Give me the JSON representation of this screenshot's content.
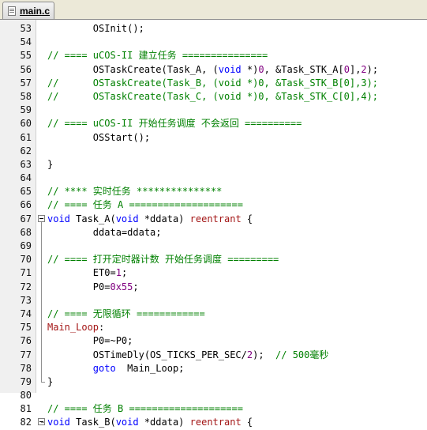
{
  "tab": {
    "label": "main.c",
    "icon": "file-icon"
  },
  "colors": {
    "comment": "#008000",
    "keyword": "#0000ff",
    "number": "#800080",
    "label": "#a31515",
    "gutter_bg": "#f0f0f0"
  },
  "lines": [
    {
      "n": "53",
      "segs": [
        {
          "t": "        "
        },
        {
          "t": "OSInit();"
        }
      ]
    },
    {
      "n": "54",
      "segs": []
    },
    {
      "n": "55",
      "segs": [
        {
          "t": "// ==== uCOS-II 建立任务 ===============",
          "c": "comment"
        }
      ]
    },
    {
      "n": "56",
      "segs": [
        {
          "t": "        OSTaskCreate(Task_A, ("
        },
        {
          "t": "void",
          "c": "keyword"
        },
        {
          "t": " *)"
        },
        {
          "t": "0",
          "c": "number"
        },
        {
          "t": ", &Task_STK_A["
        },
        {
          "t": "0",
          "c": "number"
        },
        {
          "t": "],"
        },
        {
          "t": "2",
          "c": "number"
        },
        {
          "t": ");"
        }
      ]
    },
    {
      "n": "57",
      "segs": [
        {
          "t": "//      OSTaskCreate(Task_B, (void *)0, &Task_STK_B[0],3);",
          "c": "comment"
        }
      ]
    },
    {
      "n": "58",
      "segs": [
        {
          "t": "//      OSTaskCreate(Task_C, (void *)0, &Task_STK_C[0],4);",
          "c": "comment"
        }
      ]
    },
    {
      "n": "59",
      "segs": []
    },
    {
      "n": "60",
      "segs": [
        {
          "t": "// ==== uCOS-II 开始任务调度 不会返回 ==========",
          "c": "comment"
        }
      ]
    },
    {
      "n": "61",
      "segs": [
        {
          "t": "        OSStart();"
        }
      ]
    },
    {
      "n": "62",
      "segs": []
    },
    {
      "n": "63",
      "segs": [
        {
          "t": "}"
        }
      ]
    },
    {
      "n": "64",
      "segs": []
    },
    {
      "n": "65",
      "segs": [
        {
          "t": "// **** 实时任务 ***************",
          "c": "comment"
        }
      ]
    },
    {
      "n": "66",
      "segs": [
        {
          "t": "// ==== 任务 A ====================",
          "c": "comment"
        }
      ]
    },
    {
      "n": "67",
      "segs": [
        {
          "t": "void",
          "c": "keyword"
        },
        {
          "t": " Task_A("
        },
        {
          "t": "void",
          "c": "keyword"
        },
        {
          "t": " *ddata) "
        },
        {
          "t": "reentrant",
          "c": "label"
        },
        {
          "t": " {"
        }
      ]
    },
    {
      "n": "68",
      "segs": [
        {
          "t": "        ddata=ddata;"
        }
      ]
    },
    {
      "n": "69",
      "segs": []
    },
    {
      "n": "70",
      "segs": [
        {
          "t": "// ==== 打开定时器计数 开始任务调度 =========",
          "c": "comment"
        }
      ]
    },
    {
      "n": "71",
      "segs": [
        {
          "t": "        ET0="
        },
        {
          "t": "1",
          "c": "number"
        },
        {
          "t": ";"
        }
      ]
    },
    {
      "n": "72",
      "segs": [
        {
          "t": "        P0="
        },
        {
          "t": "0x55",
          "c": "number"
        },
        {
          "t": ";"
        }
      ]
    },
    {
      "n": "73",
      "segs": []
    },
    {
      "n": "74",
      "segs": [
        {
          "t": "// ==== 无限循环 ============",
          "c": "comment"
        }
      ]
    },
    {
      "n": "75",
      "segs": [
        {
          "t": "Main_Loop",
          "c": "label"
        },
        {
          "t": ":"
        }
      ]
    },
    {
      "n": "76",
      "segs": [
        {
          "t": "        P0=~P0;"
        }
      ]
    },
    {
      "n": "77",
      "segs": [
        {
          "t": "        OSTimeDly(OS_TICKS_PER_SEC/"
        },
        {
          "t": "2",
          "c": "number"
        },
        {
          "t": ");  "
        },
        {
          "t": "// 500毫秒",
          "c": "comment"
        }
      ]
    },
    {
      "n": "78",
      "segs": [
        {
          "t": "        "
        },
        {
          "t": "goto",
          "c": "keyword"
        },
        {
          "t": "  Main_Loop;"
        }
      ]
    },
    {
      "n": "79",
      "segs": [
        {
          "t": "}"
        }
      ]
    },
    {
      "n": "80",
      "segs": []
    },
    {
      "n": "81",
      "segs": [
        {
          "t": "// ==== 任务 B ====================",
          "c": "comment"
        }
      ]
    },
    {
      "n": "82",
      "segs": [
        {
          "t": "void",
          "c": "keyword"
        },
        {
          "t": " Task_B("
        },
        {
          "t": "void",
          "c": "keyword"
        },
        {
          "t": " *ddata) "
        },
        {
          "t": "reentrant",
          "c": "label"
        },
        {
          "t": " {"
        }
      ]
    }
  ]
}
